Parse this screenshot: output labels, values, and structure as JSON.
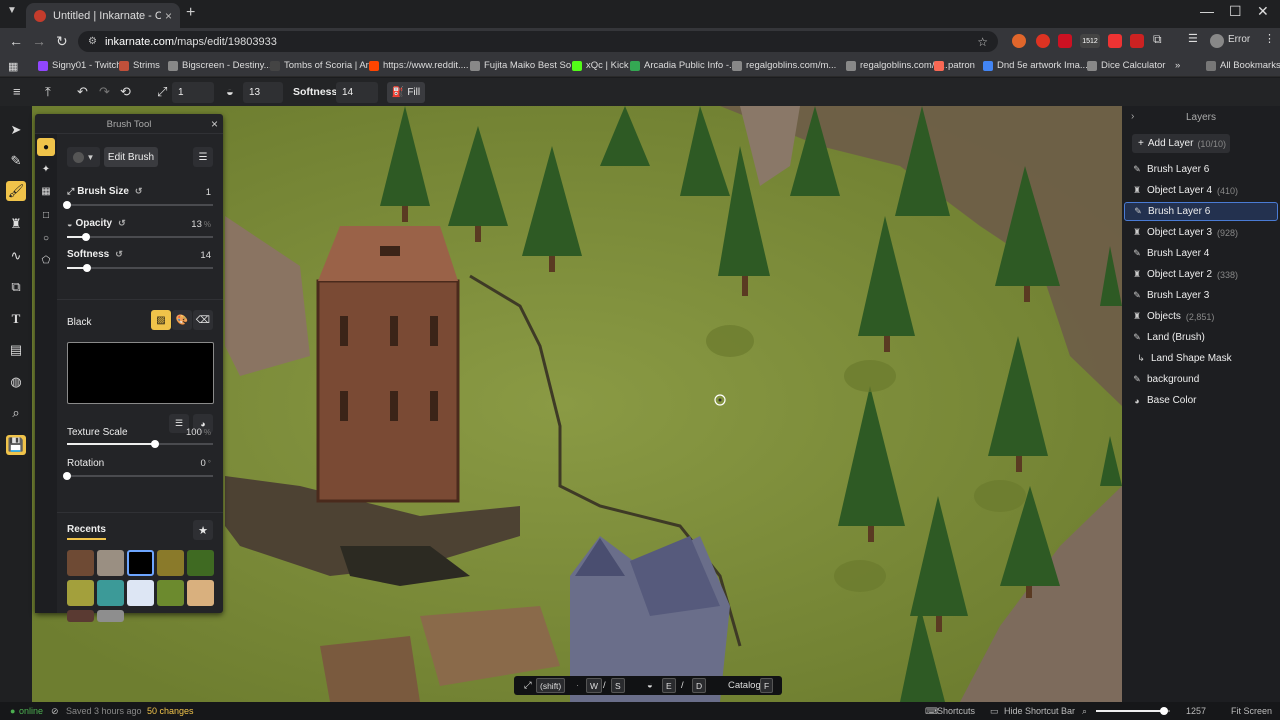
{
  "browser": {
    "tab_title": "Untitled | Inkarnate - Create Fa",
    "tab_close": "×",
    "new_tab": "+",
    "url_host": "inkarnate.com",
    "url_path": "/maps/edit/19803933",
    "profile_label": "Error",
    "ext_badge": "1512",
    "bookmarks": [
      {
        "label": "Signy01 - Twitch",
        "color": "#9146ff"
      },
      {
        "label": "Strims",
        "color": "#c0503a"
      },
      {
        "label": "Bigscreen - Destiny...",
        "color": "#888"
      },
      {
        "label": "Tombs of Scoria | Ar...",
        "color": "#444"
      },
      {
        "label": "https://www.reddit....",
        "color": "#ff4500"
      },
      {
        "label": "Fujita Maiko Best So...",
        "color": "#888"
      },
      {
        "label": "xQc | Kick",
        "color": "#53fc18"
      },
      {
        "label": "Arcadia Public Info -...",
        "color": "#34a853"
      },
      {
        "label": "regalgoblins.com/m...",
        "color": "#888"
      },
      {
        "label": "regalgoblins.com/d...",
        "color": "#888"
      },
      {
        "label": "patron",
        "color": "#f96854"
      },
      {
        "label": "Dnd 5e artwork Ima...",
        "color": "#4285f4"
      },
      {
        "label": "Dice Calculator",
        "color": "#888"
      }
    ],
    "bookmarks_more": "»",
    "all_bookmarks": "All Bookmarks"
  },
  "toolbar": {
    "size_value": "1",
    "opacity_value": "13",
    "softness_label": "Softness:",
    "softness_value": "14",
    "fill_label": "Fill"
  },
  "brush_panel": {
    "title": "Brush Tool",
    "close": "×",
    "edit_brush": "Edit Brush",
    "brush_size": {
      "label": "Brush Size",
      "value": "1",
      "fraction": 0.0
    },
    "opacity": {
      "label": "Opacity",
      "value": "13",
      "unit": "%",
      "fraction": 0.13
    },
    "softness": {
      "label": "Softness",
      "value": "14",
      "fraction": 0.14
    },
    "color_name": "Black",
    "color_hex": "#000000",
    "texture_scale": {
      "label": "Texture Scale",
      "value": "100",
      "unit": "%",
      "fraction": 0.6
    },
    "rotation": {
      "label": "Rotation",
      "value": "0",
      "unit": "°",
      "fraction": 0.0
    },
    "recents_label": "Recents",
    "recents_colors": [
      "#6e4a34",
      "#9a8f82",
      "#000000",
      "#8a7a2a",
      "#3f6a22",
      "#a3a03c",
      "#3c9a98",
      "#dde6f4",
      "#6c8a2e",
      "#d9b07e",
      "#5a3a32",
      "#8e8e8e"
    ]
  },
  "layers": {
    "title": "Layers",
    "add_label": "Add Layer",
    "add_count": "(10/10)",
    "items": [
      {
        "name": "Brush Layer 6",
        "icon": "brush-icon",
        "count": "",
        "selected": false
      },
      {
        "name": "Object Layer 4",
        "icon": "tower-icon",
        "count": "(410)",
        "selected": false
      },
      {
        "name": "Brush Layer 6",
        "icon": "brush-icon",
        "count": "",
        "selected": true
      },
      {
        "name": "Object Layer 3",
        "icon": "tower-icon",
        "count": "(928)",
        "selected": false
      },
      {
        "name": "Brush Layer 4",
        "icon": "brush-icon",
        "count": "",
        "selected": false
      },
      {
        "name": "Object Layer 2",
        "icon": "tower-icon",
        "count": "(338)",
        "selected": false
      },
      {
        "name": "Brush Layer 3",
        "icon": "brush-icon",
        "count": "",
        "selected": false
      },
      {
        "name": "Objects",
        "icon": "tower-icon",
        "count": "(2,851)",
        "selected": false
      },
      {
        "name": "Land (Brush)",
        "icon": "brush-icon",
        "count": "",
        "selected": false
      },
      {
        "name": "Land Shape Mask",
        "icon": "mask-icon",
        "count": "",
        "selected": false
      },
      {
        "name": "background",
        "icon": "brush-icon",
        "count": "",
        "selected": false
      },
      {
        "name": "Base Color",
        "icon": "palette-icon",
        "count": "",
        "selected": false
      }
    ]
  },
  "shortcut_bar": {
    "shift": "(shift)",
    "key_w": "W",
    "sep1": "/",
    "key_s": "S",
    "key_e": "E",
    "sep2": "/",
    "key_d": "D",
    "catalog": "Catalog",
    "key_f": "F"
  },
  "status": {
    "online": "online",
    "saved": "Saved 3 hours ago",
    "changes": "50 changes",
    "shortcuts": "Shortcuts",
    "hide_shortcut_bar": "Hide Shortcut Bar",
    "zoom": "1257",
    "fit_screen": "Fit Screen"
  },
  "colors": {
    "accent": "#f0c34a",
    "selected_layer": "#23314f"
  }
}
